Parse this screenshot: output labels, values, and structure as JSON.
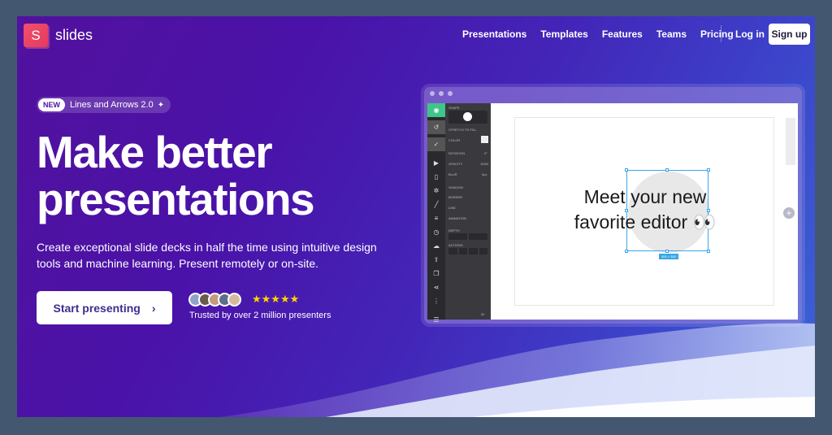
{
  "brand": {
    "logo_letter": "S",
    "name": "slides",
    "accent": "#e63a5e"
  },
  "nav": {
    "items": [
      "Presentations",
      "Templates",
      "Features",
      "Teams",
      "Pricing"
    ],
    "login": "Log in",
    "signup": "Sign up"
  },
  "badge": {
    "tag": "NEW",
    "text": "Lines and Arrows 2.0",
    "icon": "sparkle-icon"
  },
  "hero": {
    "headline_line1": "Make better",
    "headline_line2": "presentations",
    "subtext": "Create exceptional slide decks in half the time using intuitive design tools and machine learning. Present remotely or on-site.",
    "cta": "Start presenting",
    "cta_icon": "chevron-right-icon",
    "rating_stars": "★★★★★",
    "trusted": "Trusted by over 2 million presenters"
  },
  "editor": {
    "slide_text_line1": "Meet your new",
    "slide_text_line2": "favorite editor 👀",
    "inspector": {
      "shape": "SHAPE",
      "stretch": "STRETCH TO FILL",
      "color": "COLOR",
      "rotation": "ROTATION",
      "rotation_val": "0°",
      "opacity": "OPACITY",
      "opacity_val": "100%",
      "blur": "BLUR",
      "blur_val": "0px",
      "shadow": "SHADOW",
      "border": "BORDER",
      "link": "LINK",
      "animation": "ANIMATION",
      "depth": "DEPTH",
      "actions": "ACTIONS",
      "page": "52"
    },
    "size_tag": "300 × 300"
  }
}
